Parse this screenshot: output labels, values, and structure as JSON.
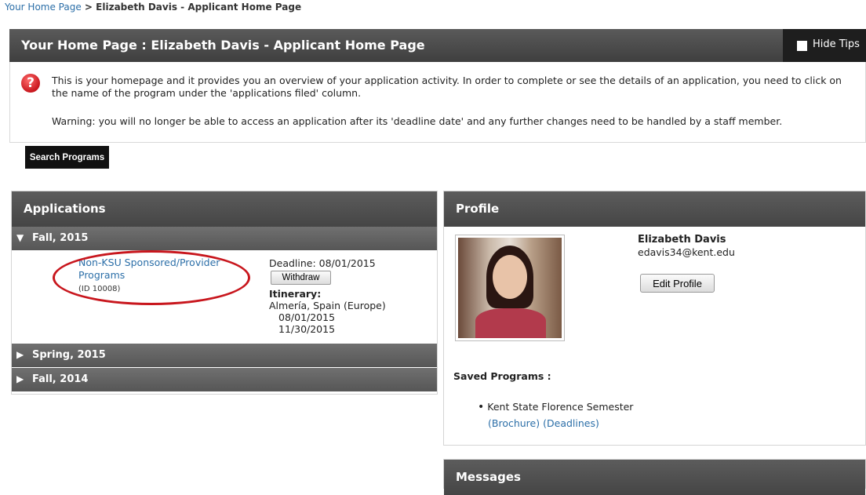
{
  "breadcrumb": {
    "home": "Your Home Page",
    "sep": " > ",
    "current": "Elizabeth Davis - Applicant Home Page"
  },
  "title": "Your Home Page : Elizabeth Davis - Applicant Home Page",
  "hide_tips": "Hide Tips",
  "tips": {
    "icon": "?",
    "line1": "This is your homepage and it provides you an overview of your application activity. In order to complete or see the details of an application, you need to click on the name of the program under the 'applications filed' column.",
    "warning": "Warning: you will no longer be able to access an application after its 'deadline date' and any further changes need to be handled by a staff member."
  },
  "search_button": "Search Programs",
  "applications": {
    "title": "Applications",
    "terms": [
      {
        "name": "Fall, 2015",
        "expanded": true
      },
      {
        "name": "Spring, 2015",
        "expanded": false
      },
      {
        "name": "Fall, 2014",
        "expanded": false
      }
    ],
    "entry": {
      "program": "Non-KSU Sponsored/Provider Programs",
      "id": "(ID 10008)",
      "deadline": "Deadline: 08/01/2015",
      "withdraw": "Withdraw",
      "itinerary_label": "Itinerary:",
      "location": "Almería, Spain (Europe)",
      "start": "08/01/2015",
      "end": "11/30/2015"
    }
  },
  "profile": {
    "title": "Profile",
    "name": "Elizabeth Davis",
    "email": "edavis34@kent.edu",
    "edit_button": "Edit Profile",
    "saved_label": "Saved Programs :",
    "saved_program": "Kent State Florence Semester",
    "links": [
      "(Brochure)",
      "(Deadlines)"
    ]
  },
  "messages": {
    "title": "Messages"
  },
  "colors": {
    "link": "#2c6fa8",
    "header": "#454545",
    "highlight": "#c8161d"
  }
}
